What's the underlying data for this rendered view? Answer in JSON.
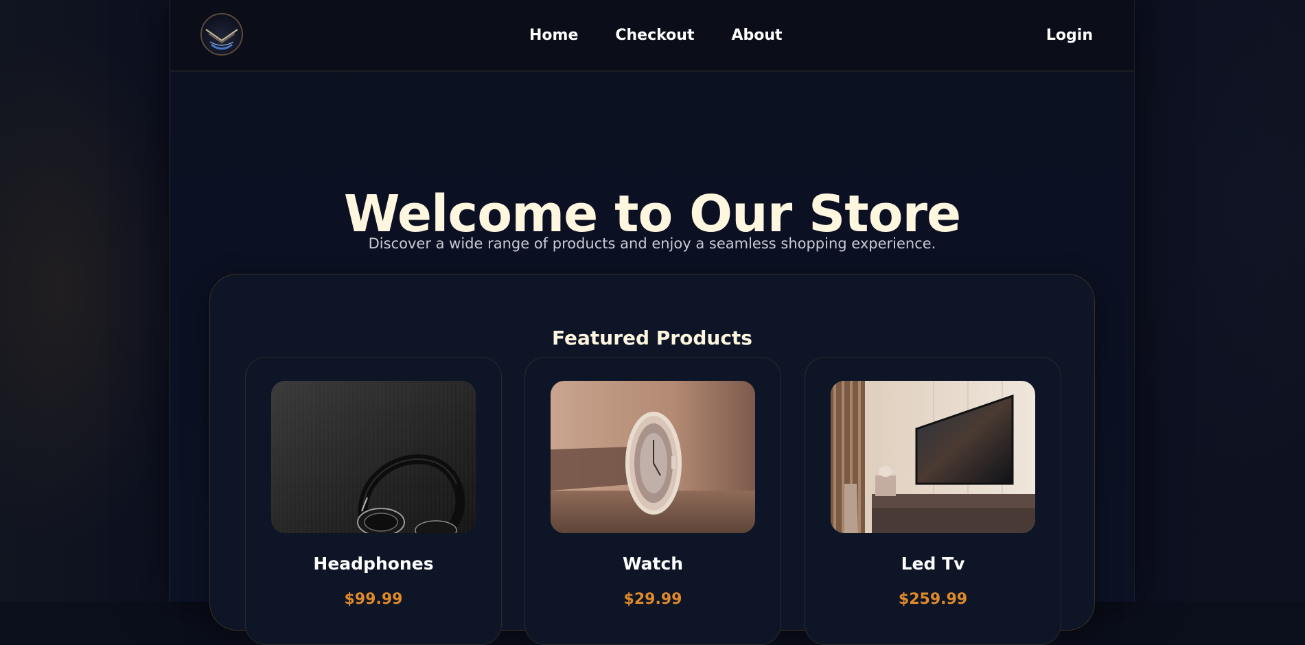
{
  "nav": {
    "logo_icon": "chevron-logo-icon",
    "links": [
      {
        "label": "Home"
      },
      {
        "label": "Checkout"
      },
      {
        "label": "About"
      }
    ],
    "login_label": "Login"
  },
  "hero": {
    "title": "Welcome to Our Store",
    "subtitle": "Discover a wide range of products and enjoy a seamless shopping experience."
  },
  "featured": {
    "title": "Featured Products",
    "products": [
      {
        "name": "Headphones",
        "price": "$99.99",
        "image": "headphones-image"
      },
      {
        "name": "Watch",
        "price": "$29.99",
        "image": "watch-image"
      },
      {
        "name": "Led Tv",
        "price": "$259.99",
        "image": "led-tv-image"
      }
    ]
  },
  "colors": {
    "accent_price": "#e0892a",
    "heading": "#fff6e0",
    "background": "#0b1122",
    "card_border": "#3a3026"
  }
}
